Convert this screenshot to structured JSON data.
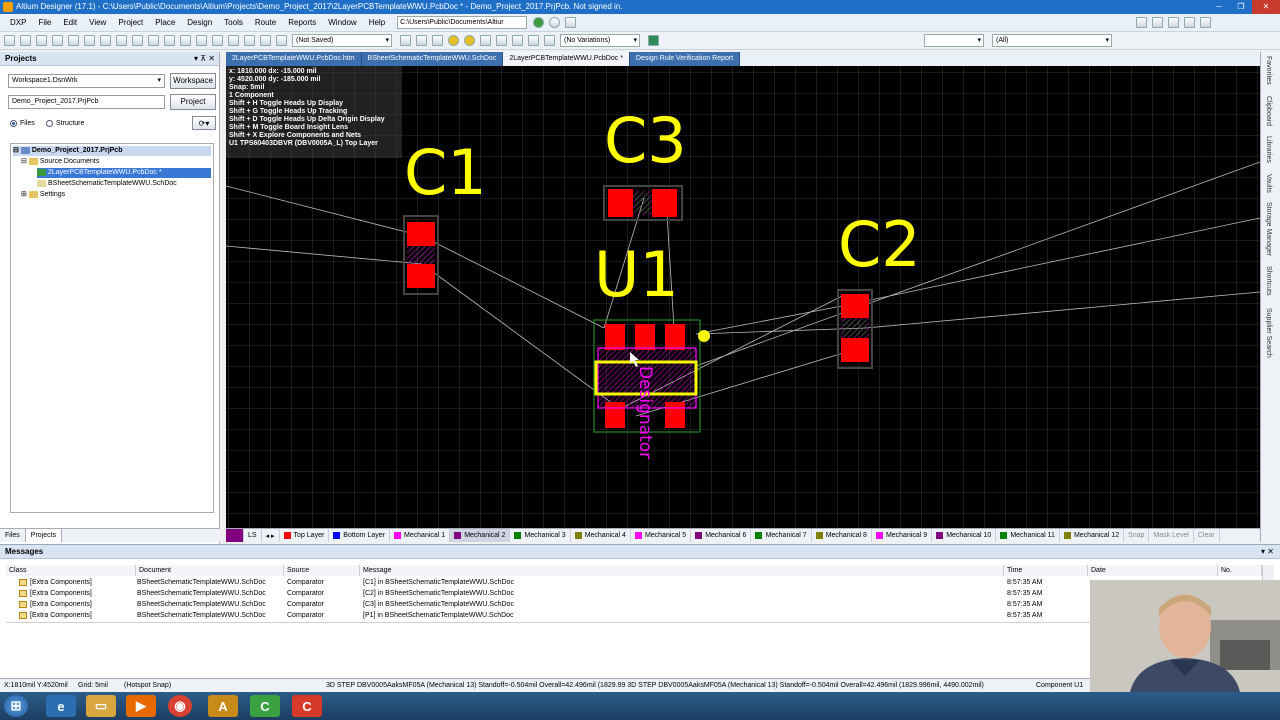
{
  "window": {
    "title": "Altium Designer (17.1) - C:\\Users\\Public\\Documents\\Altium\\Projects\\Demo_Project_2017\\2LayerPCBTemplateWWU.PcbDoc * - Demo_Project_2017.PrjPcb. Not signed in."
  },
  "menu": {
    "items": [
      "DXP",
      "File",
      "Edit",
      "View",
      "Project",
      "Place",
      "Design",
      "Tools",
      "Route",
      "Reports",
      "Window",
      "Help"
    ],
    "path": "C:\\Users\\Public\\Documents\\Altiur"
  },
  "toolbar": {
    "save_state": "(Not Saved)",
    "variations": "(No Variations)",
    "filter": "(All)"
  },
  "projects_panel": {
    "title": "Projects",
    "workspace_value": "Workspace1.DsnWrk",
    "workspace_button": "Workspace",
    "project_value": "Demo_Project_2017.PrjPcb",
    "project_button": "Project",
    "view_files": "Files",
    "view_structure": "Structure",
    "tree": {
      "project": "Demo_Project_2017.PrjPcb",
      "source_folder": "Source Documents",
      "pcb_doc": "2LayerPCBTemplateWWU.PcbDoc *",
      "sch_doc": "BSheetSchematicTemplateWWU.SchDoc",
      "settings": "Settings"
    },
    "bottom_tabs": [
      "Files",
      "Projects"
    ]
  },
  "doc_tabs": [
    {
      "label": "2LayerPCBTemplateWWU.PcbDoc.htm",
      "active": false
    },
    {
      "label": "BSheetSchematicTemplateWWU.SchDoc",
      "active": false
    },
    {
      "label": "2LayerPCBTemplateWWU.PcbDoc *",
      "active": true
    },
    {
      "label": "Design Rule Verification Report",
      "active": false
    }
  ],
  "hud": {
    "lines": [
      "x: 1810.000  dx: -15.000 mil",
      "y: 4520.000  dy: -185.000 mil",
      "Snap: 5mil",
      "1 Component",
      "Shift + H  Toggle Heads Up Display",
      "Shift + G  Toggle Heads Up Tracking",
      "Shift + D  Toggle Heads Up Delta Origin Display",
      "Shift + M  Toggle Board Insight Lens",
      "Shift + X  Explore Components and Nets",
      "U1  TPS60403DBVR (DBV0005A_L)  Top Layer"
    ]
  },
  "designators": {
    "c1": "C1",
    "c2": "C2",
    "c3": "C3",
    "u1": "U1",
    "designator_text": "Designator"
  },
  "right_panels": [
    "Favorites",
    "Clipboard",
    "Libraries",
    "Vaults",
    "Storage Manager",
    "Shortcuts",
    "Supplier Search"
  ],
  "layers": {
    "tabs": [
      {
        "name": "Top Layer",
        "color": "#ff0000",
        "active": false
      },
      {
        "name": "Bottom Layer",
        "color": "#0000ff",
        "active": false
      },
      {
        "name": "Mechanical 1",
        "color": "#ff00ff",
        "active": false
      },
      {
        "name": "Mechanical 2",
        "color": "#800080",
        "active": true
      },
      {
        "name": "Mechanical 3",
        "color": "#008000",
        "active": false
      },
      {
        "name": "Mechanical 4",
        "color": "#808000",
        "active": false
      },
      {
        "name": "Mechanical 5",
        "color": "#ff00ff",
        "active": false
      },
      {
        "name": "Mechanical 6",
        "color": "#800080",
        "active": false
      },
      {
        "name": "Mechanical 7",
        "color": "#008000",
        "active": false
      },
      {
        "name": "Mechanical 8",
        "color": "#808000",
        "active": false
      },
      {
        "name": "Mechanical 9",
        "color": "#ff00ff",
        "active": false
      },
      {
        "name": "Mechanical 10",
        "color": "#800080",
        "active": false
      },
      {
        "name": "Mechanical 11",
        "color": "#008000",
        "active": false
      },
      {
        "name": "Mechanical 12",
        "color": "#808000",
        "active": false
      }
    ],
    "controls": [
      "Snap",
      "Mask Level",
      "Clear"
    ],
    "ls": "LS"
  },
  "messages": {
    "title": "Messages",
    "columns": [
      "Class",
      "Document",
      "Source",
      "Message",
      "Time",
      "Date",
      "No."
    ],
    "rows": [
      {
        "class": "[Extra Components]",
        "document": "BSheetSchematicTemplateWWU.SchDoc",
        "source": "Comparator",
        "message": "[C1] in BSheetSchematicTemplateWWU.SchDoc",
        "time": "8:57:35 AM"
      },
      {
        "class": "[Extra Components]",
        "document": "BSheetSchematicTemplateWWU.SchDoc",
        "source": "Comparator",
        "message": "[C2] in BSheetSchematicTemplateWWU.SchDoc",
        "time": "8:57:35 AM"
      },
      {
        "class": "[Extra Components]",
        "document": "BSheetSchematicTemplateWWU.SchDoc",
        "source": "Comparator",
        "message": "[C3] in BSheetSchematicTemplateWWU.SchDoc",
        "time": "8:57:35 AM"
      },
      {
        "class": "[Extra Components]",
        "document": "BSheetSchematicTemplateWWU.SchDoc",
        "source": "Comparator",
        "message": "[P1] in BSheetSchematicTemplateWWU.SchDoc",
        "time": "8:57:35 AM"
      }
    ]
  },
  "status": {
    "coords": "X:1810mil Y:4520mil",
    "grid": "Grid: 5mil",
    "snap": "(Hotspot Snap)",
    "info": "3D STEP DBV0005AaksMF05A (Mechanical 13)  Standoff=-0.504mil  Overall=42.496mil  (1829.99 3D STEP DBV0005AaksMF05A (Mechanical 13)  Standoff=-0.504mil  Overall=42.496mil  (1829.996mil, 4490.002mil)",
    "component": "Component U1"
  },
  "colors": {
    "canvas_bg": "#000000",
    "grid": "#5a5a5a",
    "pad": "#ff0000",
    "overlay": "#ffff00",
    "mech": "#ff00ff"
  }
}
